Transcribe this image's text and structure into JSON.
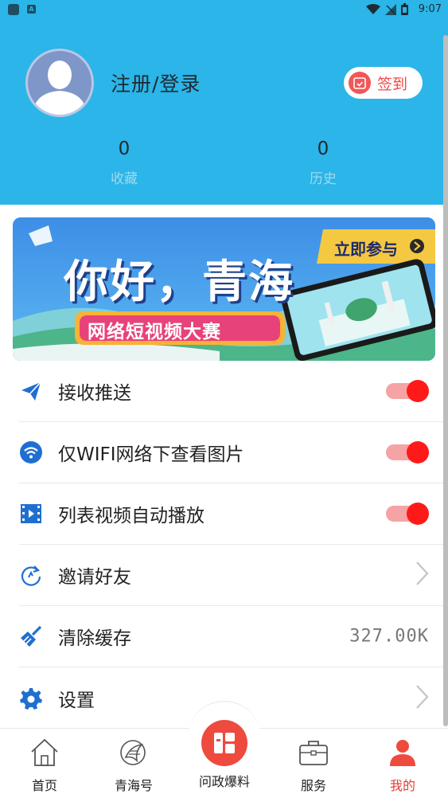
{
  "status_bar": {
    "time": "9:07",
    "left_icons": [
      "app-square-icon",
      "a-icon"
    ],
    "right_icons": [
      "wifi-icon",
      "no-signal-icon",
      "battery-icon"
    ],
    "a_badge": "A"
  },
  "profile": {
    "login_label": "注册/登录",
    "signin_label": "签到",
    "favorites_count": "0",
    "favorites_label": "收藏",
    "history_count": "0",
    "history_label": "历史"
  },
  "banner": {
    "title": "你好，青海",
    "subtitle": "网络短视频大赛",
    "cta": "立即参与"
  },
  "settings": [
    {
      "label": "接收推送",
      "icon": "send-icon",
      "control": "toggle",
      "on": true
    },
    {
      "label": "仅WIFI网络下查看图片",
      "icon": "wifi-circle-icon",
      "control": "toggle",
      "on": true
    },
    {
      "label": "列表视频自动播放",
      "icon": "video-film-icon",
      "control": "toggle",
      "on": true
    },
    {
      "label": "邀请好友",
      "icon": "refresh-arrow-icon",
      "control": "chevron"
    },
    {
      "label": "清除缓存",
      "icon": "broom-icon",
      "control": "value",
      "value": "327.00K"
    },
    {
      "label": "设置",
      "icon": "gear-icon",
      "control": "chevron"
    }
  ],
  "bottom_nav": [
    {
      "label": "首页",
      "icon": "home-icon"
    },
    {
      "label": "青海号",
      "icon": "qinghai-logo-icon"
    },
    {
      "label": "问政爆料",
      "icon": "grid-report-icon"
    },
    {
      "label": "服务",
      "icon": "briefcase-icon"
    },
    {
      "label": "我的",
      "icon": "person-icon",
      "active": true
    }
  ],
  "colors": {
    "header_bg": "#2bb5e8",
    "accent_red": "#ee4a3e",
    "toggle_on": "#ff1a1a",
    "icon_blue": "#1f6fd1"
  }
}
